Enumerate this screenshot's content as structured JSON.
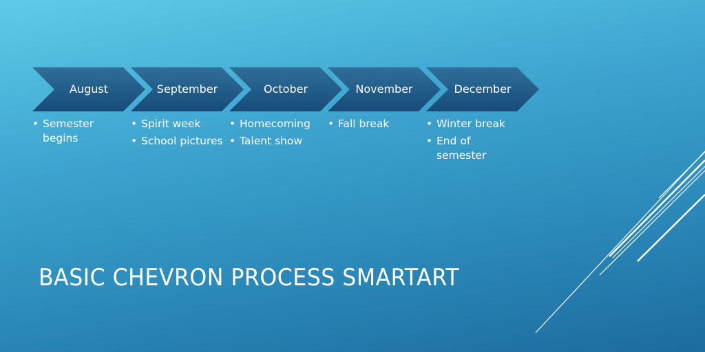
{
  "slide": {
    "title": "BASIC CHEVRON PROCESS SMARTART",
    "colors": {
      "chevron_top": "#2f6f99",
      "chevron_bottom": "#174b7a",
      "text": "#ffffff"
    },
    "steps": [
      {
        "label": "August",
        "bullets": [
          "Semester begins"
        ]
      },
      {
        "label": "September",
        "bullets": [
          "Spirit week",
          "School pictures"
        ]
      },
      {
        "label": "October",
        "bullets": [
          "Homecoming",
          "Talent show"
        ]
      },
      {
        "label": "November",
        "bullets": [
          "Fall break"
        ]
      },
      {
        "label": "December",
        "bullets": [
          "Winter break",
          "End of semester"
        ]
      }
    ]
  }
}
